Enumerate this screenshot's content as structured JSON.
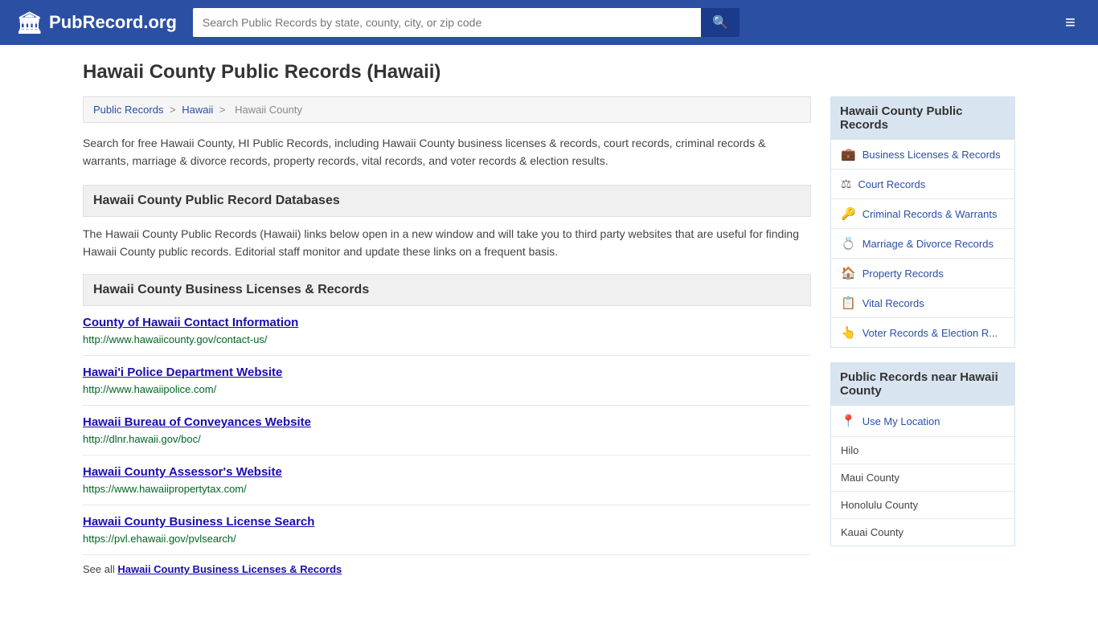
{
  "header": {
    "logo_text": "PubRecord.org",
    "logo_icon": "🏛",
    "search_placeholder": "Search Public Records by state, county, city, or zip code",
    "search_button_icon": "🔍",
    "menu_icon": "≡"
  },
  "page": {
    "title": "Hawaii County Public Records (Hawaii)",
    "breadcrumb": {
      "items": [
        "Public Records",
        "Hawaii",
        "Hawaii County"
      ]
    },
    "description": "Search for free Hawaii County, HI Public Records, including Hawaii County business licenses & records, court records, criminal records & warrants, marriage & divorce records, property records, vital records, and voter records & election results.",
    "databases_section": {
      "header": "Hawaii County Public Record Databases",
      "body": "The Hawaii County Public Records (Hawaii) links below open in a new window and will take you to third party websites that are useful for finding Hawaii County public records. Editorial staff monitor and update these links on a frequent basis."
    },
    "business_section": {
      "header": "Hawaii County Business Licenses & Records",
      "entries": [
        {
          "title": "County of Hawaii Contact Information",
          "url": "http://www.hawaiicounty.gov/contact-us/"
        },
        {
          "title": "Hawai'i Police Department Website",
          "url": "http://www.hawaiipolice.com/"
        },
        {
          "title": "Hawaii Bureau of Conveyances Website",
          "url": "http://dlnr.hawaii.gov/boc/"
        },
        {
          "title": "Hawaii County Assessor's Website",
          "url": "https://www.hawaiipropertytax.com/"
        },
        {
          "title": "Hawaii County Business License Search",
          "url": "https://pvl.ehawaii.gov/pvlsearch/"
        }
      ],
      "see_all_prefix": "See all ",
      "see_all_link": "Hawaii County Business Licenses & Records"
    }
  },
  "sidebar": {
    "public_records_title": "Hawaii County Public Records",
    "items": [
      {
        "label": "Business Licenses & Records",
        "icon": "💼"
      },
      {
        "label": "Court Records",
        "icon": "⚖"
      },
      {
        "label": "Criminal Records & Warrants",
        "icon": "🔑"
      },
      {
        "label": "Marriage & Divorce Records",
        "icon": "💍"
      },
      {
        "label": "Property Records",
        "icon": "🏠"
      },
      {
        "label": "Vital Records",
        "icon": "📋"
      },
      {
        "label": "Voter Records & Election R...",
        "icon": "👆"
      }
    ],
    "nearby_title": "Public Records near Hawaii County",
    "use_my_location": "Use My Location",
    "nearby_places": [
      "Hilo",
      "Maui County",
      "Honolulu County",
      "Kauai County"
    ]
  }
}
